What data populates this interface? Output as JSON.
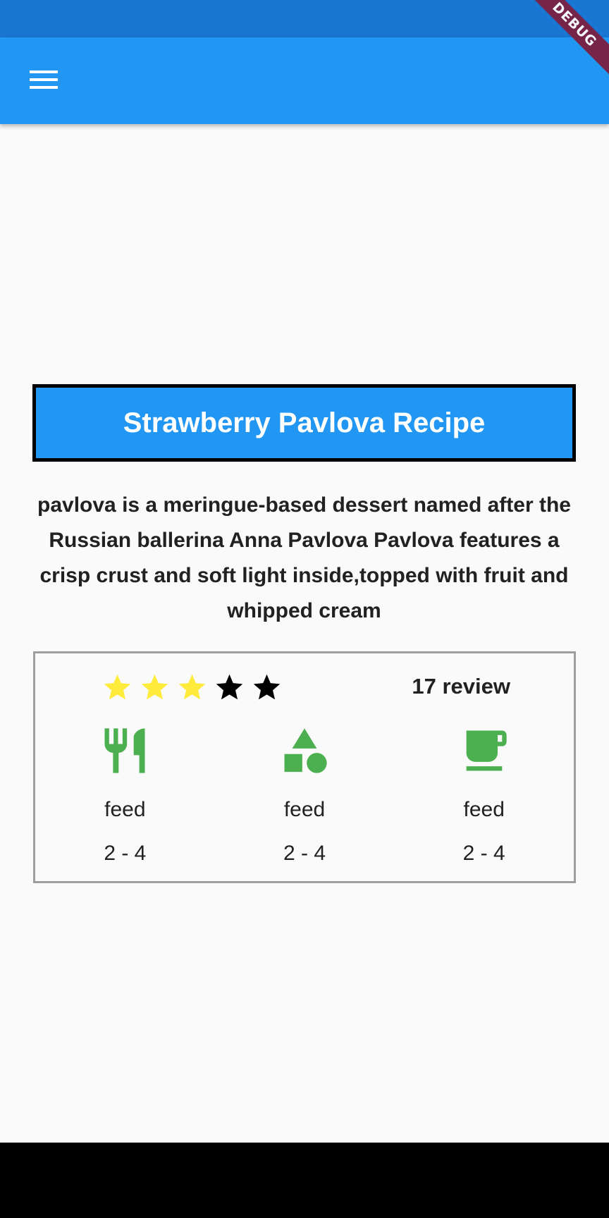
{
  "status_bar": {
    "color": "#1976d2"
  },
  "app_bar": {
    "color": "#2196f3",
    "menu_icon": "hamburger-menu-icon"
  },
  "debug_banner": {
    "label": "DEBUG"
  },
  "recipe": {
    "title": "Strawberry Pavlova Recipe",
    "description": "pavlova is a meringue-based dessert named after the Russian ballerina Anna Pavlova Pavlova features a crisp crust and soft light inside,topped with fruit and whipped cream"
  },
  "rating": {
    "filled_stars": 3,
    "total_stars": 5,
    "filled_color": "#ffeb3b",
    "empty_color": "#000000",
    "review_label": "17 review"
  },
  "info_columns": [
    {
      "icon": "restaurant-icon",
      "label": "feed",
      "value": "2 - 4"
    },
    {
      "icon": "category-shapes-icon",
      "label": "feed",
      "value": "2 - 4"
    },
    {
      "icon": "coffee-cup-icon",
      "label": "feed",
      "value": "2 - 4"
    }
  ],
  "icon_color": "#4caf50"
}
